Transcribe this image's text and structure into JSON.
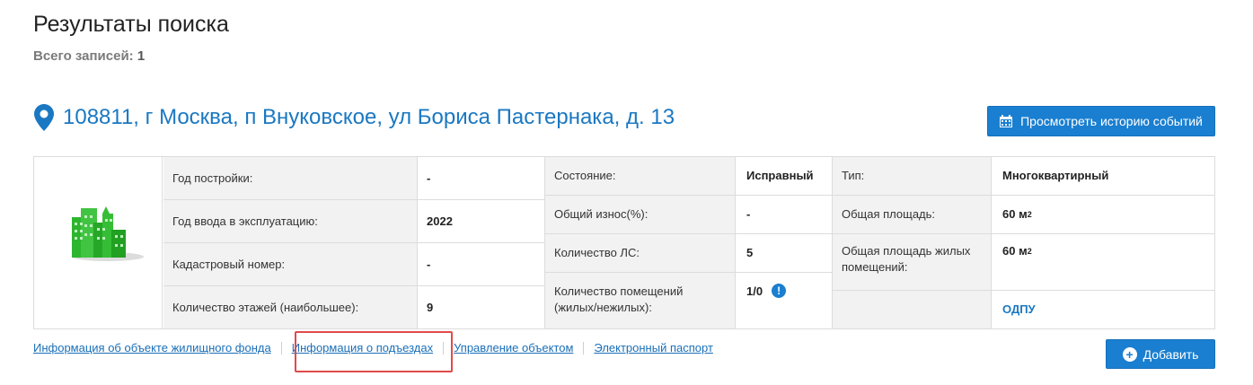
{
  "header": {
    "title": "Результаты поиска",
    "total_label": "Всего записей:",
    "total_count": "1"
  },
  "address": {
    "icon": "map-marker-icon",
    "text": "108811, г Москва, п Внуковское, ул Бориса Пастернака, д. 13"
  },
  "history_button": {
    "icon": "calendar-icon",
    "label": "Просмотреть историю событий"
  },
  "building_image": "building-icon",
  "col1": [
    {
      "label": "Год постройки:",
      "value": "-"
    },
    {
      "label": "Год ввода в эксплуатацию:",
      "value": "2022"
    },
    {
      "label": "Кадастровый номер:",
      "value": "-"
    },
    {
      "label": "Количество этажей (наибольшее):",
      "value": "9"
    }
  ],
  "col2": [
    {
      "label": "Состояние:",
      "value": "Исправный"
    },
    {
      "label": "Общий износ(%):",
      "value": "-"
    },
    {
      "label": "Количество ЛС:",
      "value": "5"
    },
    {
      "label": "Количество помещений (жилых/нежилых):",
      "value": "1/0",
      "badge": "!"
    }
  ],
  "col3": [
    {
      "label": "Тип:",
      "value": "Многоквартирный"
    },
    {
      "label": "Общая площадь:",
      "value": "60 м",
      "sup": "2"
    },
    {
      "label": "Общая площадь жилых помещений:",
      "value": "60 м",
      "sup": "2"
    },
    {
      "label": "",
      "value": "ОДПУ"
    }
  ],
  "links": [
    "Информация об объекте жилищного фонда",
    "Информация о подъездах",
    "Управление объектом",
    "Электронный паспорт"
  ],
  "add_button": {
    "label": "Добавить",
    "icon": "plus-circle-icon"
  },
  "colors": {
    "accent": "#1a7fd0",
    "link": "#1a78c2",
    "highlight": "#e14a4a",
    "building": "#2db52d"
  }
}
